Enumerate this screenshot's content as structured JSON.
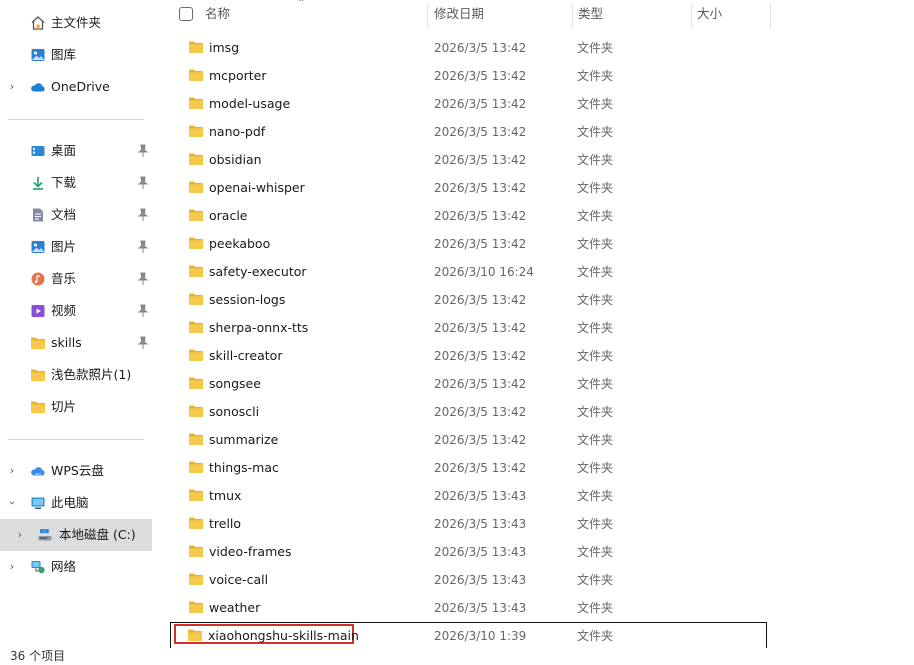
{
  "sidebar": {
    "home": {
      "label": "主文件夹"
    },
    "gallery": {
      "label": "图库"
    },
    "onedrive": {
      "label": "OneDrive"
    },
    "quick": [
      {
        "label": "桌面",
        "icon": "desktop-icon"
      },
      {
        "label": "下载",
        "icon": "download-icon"
      },
      {
        "label": "文档",
        "icon": "document-icon"
      },
      {
        "label": "图片",
        "icon": "pictures-icon"
      },
      {
        "label": "音乐",
        "icon": "music-icon"
      },
      {
        "label": "视频",
        "icon": "video-icon"
      },
      {
        "label": "skills",
        "icon": "folder-icon"
      },
      {
        "label": "浅色款照片(1)",
        "icon": "folder-icon"
      },
      {
        "label": "切片",
        "icon": "folder-icon"
      }
    ],
    "wps": {
      "label": "WPS云盘"
    },
    "thispc": {
      "label": "此电脑"
    },
    "localdisk": {
      "label": "本地磁盘 (C:)"
    },
    "network": {
      "label": "网络"
    }
  },
  "columns": {
    "name": "名称",
    "date": "修改日期",
    "type": "类型",
    "size": "大小"
  },
  "files": [
    {
      "name": "imsg",
      "date": "2026/3/5 13:42",
      "type": "文件夹"
    },
    {
      "name": "mcporter",
      "date": "2026/3/5 13:42",
      "type": "文件夹"
    },
    {
      "name": "model-usage",
      "date": "2026/3/5 13:42",
      "type": "文件夹"
    },
    {
      "name": "nano-pdf",
      "date": "2026/3/5 13:42",
      "type": "文件夹"
    },
    {
      "name": "obsidian",
      "date": "2026/3/5 13:42",
      "type": "文件夹"
    },
    {
      "name": "openai-whisper",
      "date": "2026/3/5 13:42",
      "type": "文件夹"
    },
    {
      "name": "oracle",
      "date": "2026/3/5 13:42",
      "type": "文件夹"
    },
    {
      "name": "peekaboo",
      "date": "2026/3/5 13:42",
      "type": "文件夹"
    },
    {
      "name": "safety-executor",
      "date": "2026/3/10 16:24",
      "type": "文件夹"
    },
    {
      "name": "session-logs",
      "date": "2026/3/5 13:42",
      "type": "文件夹"
    },
    {
      "name": "sherpa-onnx-tts",
      "date": "2026/3/5 13:42",
      "type": "文件夹"
    },
    {
      "name": "skill-creator",
      "date": "2026/3/5 13:42",
      "type": "文件夹"
    },
    {
      "name": "songsee",
      "date": "2026/3/5 13:42",
      "type": "文件夹"
    },
    {
      "name": "sonoscli",
      "date": "2026/3/5 13:42",
      "type": "文件夹"
    },
    {
      "name": "summarize",
      "date": "2026/3/5 13:42",
      "type": "文件夹"
    },
    {
      "name": "things-mac",
      "date": "2026/3/5 13:42",
      "type": "文件夹"
    },
    {
      "name": "tmux",
      "date": "2026/3/5 13:43",
      "type": "文件夹"
    },
    {
      "name": "trello",
      "date": "2026/3/5 13:43",
      "type": "文件夹"
    },
    {
      "name": "video-frames",
      "date": "2026/3/5 13:43",
      "type": "文件夹"
    },
    {
      "name": "voice-call",
      "date": "2026/3/5 13:43",
      "type": "文件夹"
    },
    {
      "name": "weather",
      "date": "2026/3/5 13:43",
      "type": "文件夹"
    },
    {
      "name": "xiaohongshu-skills-main",
      "date": "2026/3/10 1:39",
      "type": "文件夹"
    }
  ],
  "status": {
    "item_count": "36 个项目"
  },
  "colors": {
    "folder": "#f6c94a",
    "folder_dark": "#e9b531",
    "selected_bg": "#dcdcdc",
    "highlight": "#d32f2f",
    "onedrive": "#1e7fd8"
  }
}
